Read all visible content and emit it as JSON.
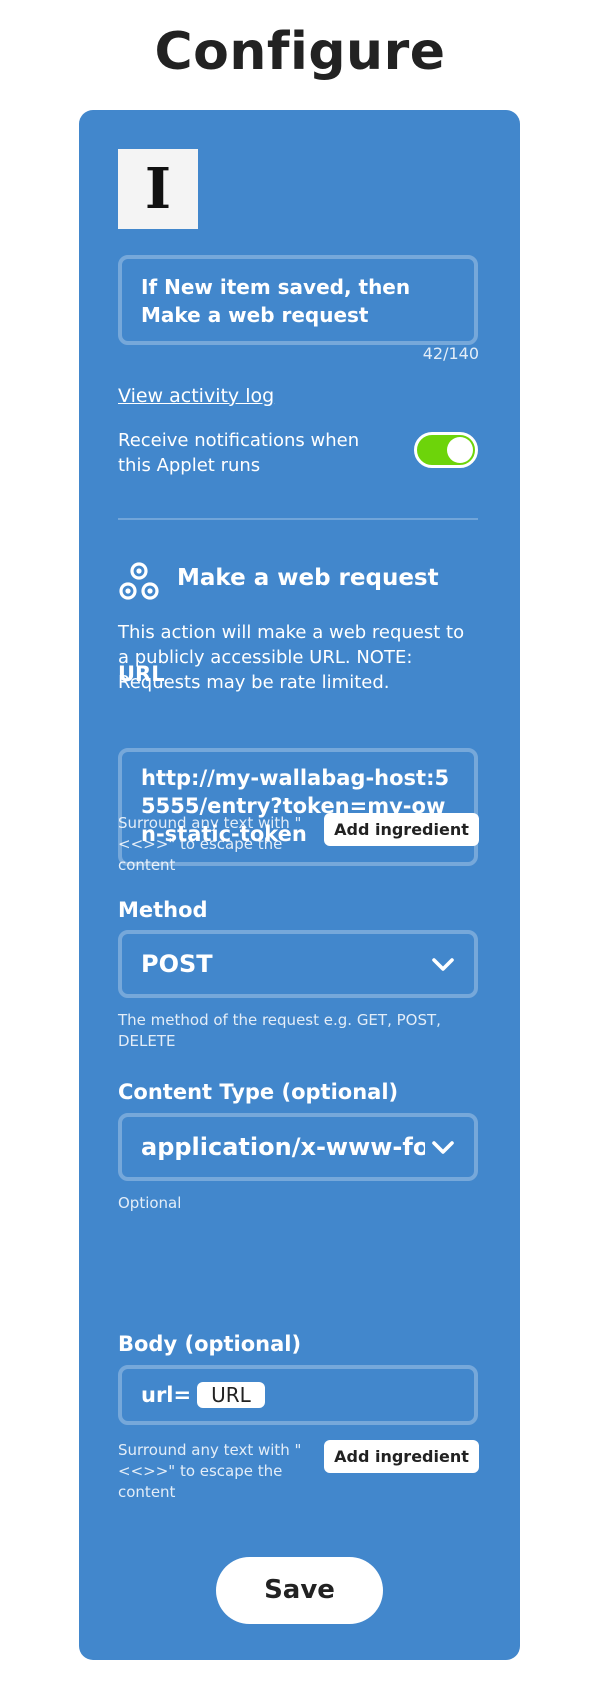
{
  "page": {
    "title": "Configure"
  },
  "applet": {
    "service_logo_letter": "I",
    "title": "If New item saved, then Make a web request",
    "char_count": "42/140",
    "activity_link": "View activity log",
    "notify_text": "Receive notifications when this Applet runs",
    "notify_enabled": true
  },
  "action": {
    "icon": "webhook-icon",
    "title": "Make a web request",
    "description": "This action will make a web request to a publicly accessible URL. NOTE: Requests may be rate limited."
  },
  "fields": {
    "url": {
      "label": "URL",
      "value": "http://my-wallabag-host:55555/entry?token=my-own-static-token",
      "helper": "Surround any text with \"<<>>\" to escape the content",
      "ingredient_button": "Add ingredient"
    },
    "method": {
      "label": "Method",
      "value": "POST",
      "helper": "The method of the request e.g. GET, POST, DELETE"
    },
    "content_type": {
      "label": "Content Type (optional)",
      "value": "application/x-www-form-urlencoded",
      "helper": "Optional"
    },
    "body": {
      "label": "Body (optional)",
      "prefix": "url=",
      "ingredient": "URL",
      "helper": "Surround any text with \"<<>>\" to escape the content",
      "ingredient_button": "Add ingredient"
    }
  },
  "save_button": "Save",
  "colors": {
    "card": "#4287cc",
    "toggle_on": "#6dd40a",
    "title": "#222222"
  }
}
